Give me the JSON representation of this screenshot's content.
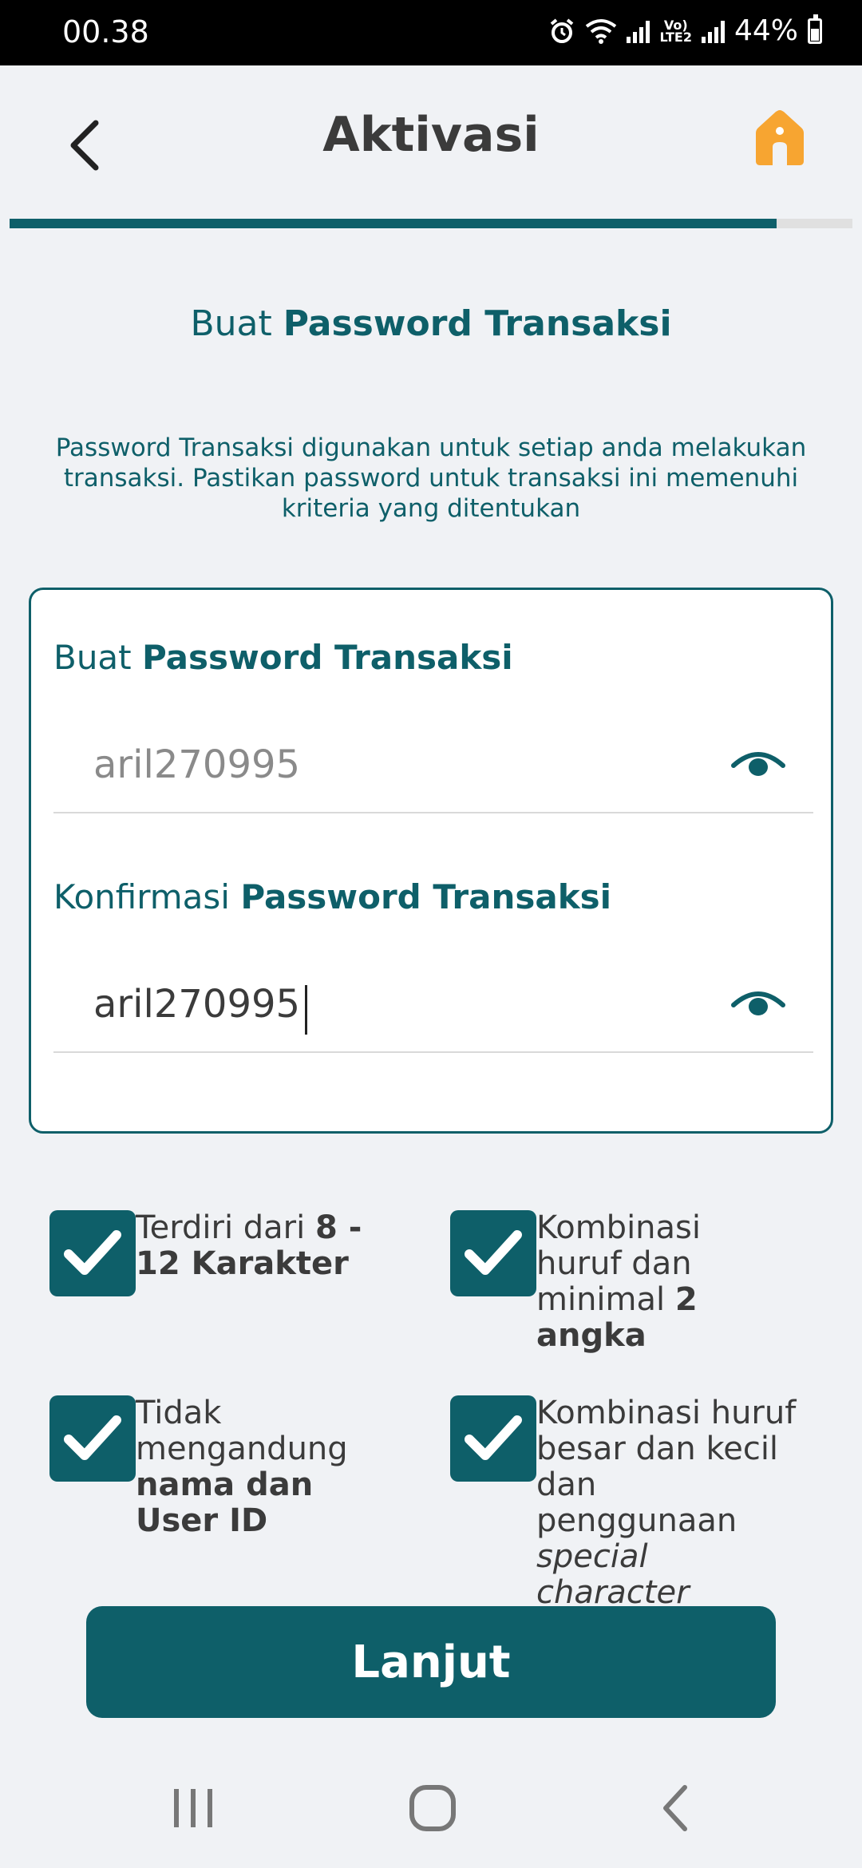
{
  "status_bar": {
    "time": "00.38",
    "battery": "44%",
    "network": "LTE2"
  },
  "header": {
    "title": "Aktivasi"
  },
  "progress": {
    "fraction": 0.91
  },
  "section": {
    "title_prefix": "Buat ",
    "title_bold": "Password Transaksi"
  },
  "description": "Password Transaksi digunakan untuk setiap anda melakukan transaksi. Pastikan password untuk transaksi ini memenuhi kriteria yang ditentukan",
  "form": {
    "password": {
      "label_prefix": "Buat ",
      "label_bold": "Password Transaksi",
      "value": "aril270995"
    },
    "confirm": {
      "label_prefix": "Konfirmasi ",
      "label_bold": "Password Transaksi",
      "value": "aril270995"
    }
  },
  "criteria": [
    {
      "plain": "Terdiri dari ",
      "bold": "8 - 12 Karakter"
    },
    {
      "plain": "Kombinasi huruf dan minimal ",
      "bold": "2 angka"
    },
    {
      "plain": "Tidak mengandung ",
      "bold": "nama dan User ID"
    },
    {
      "plain": "Kombinasi huruf besar dan kecil dan penggunaan ",
      "italic": "special character"
    }
  ],
  "buttons": {
    "next": "Lanjut"
  },
  "colors": {
    "primary": "#0e5f69",
    "accent": "#f7a531",
    "background": "#f0f2f5"
  }
}
